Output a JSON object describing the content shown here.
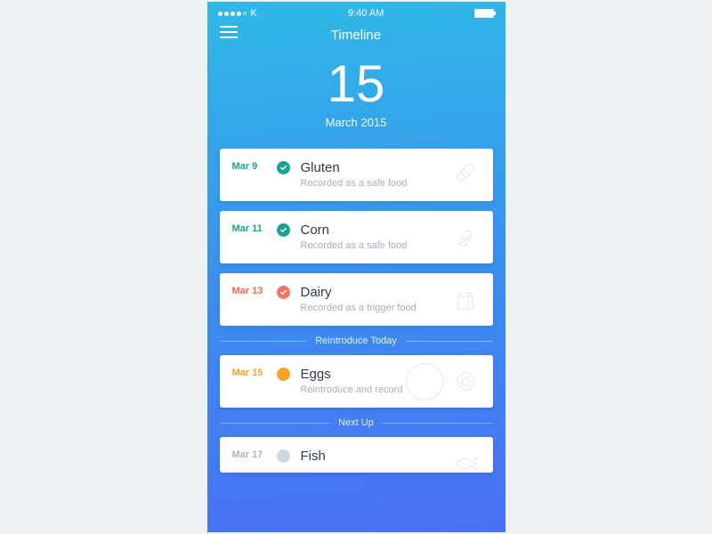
{
  "status": {
    "carrier": "K",
    "time": "9:40 AM"
  },
  "header": {
    "title": "Timeline"
  },
  "bigdate": {
    "day": "15",
    "month": "March 2015"
  },
  "cards": [
    {
      "date": "Mar 9",
      "name": "Gluten",
      "sub": "Recorded as a safe food"
    },
    {
      "date": "Mar 11",
      "name": "Corn",
      "sub": "Recorded as a safe food"
    },
    {
      "date": "Mar 13",
      "name": "Dairy",
      "sub": "Recorded as a trigger food"
    },
    {
      "date": "Mar 15",
      "name": "Eggs",
      "sub": "Reintroduce and record"
    },
    {
      "date": "Mar 17",
      "name": "Fish",
      "sub": ""
    }
  ],
  "dividers": {
    "today": "Reintroduce Today",
    "next": "Next Up"
  }
}
